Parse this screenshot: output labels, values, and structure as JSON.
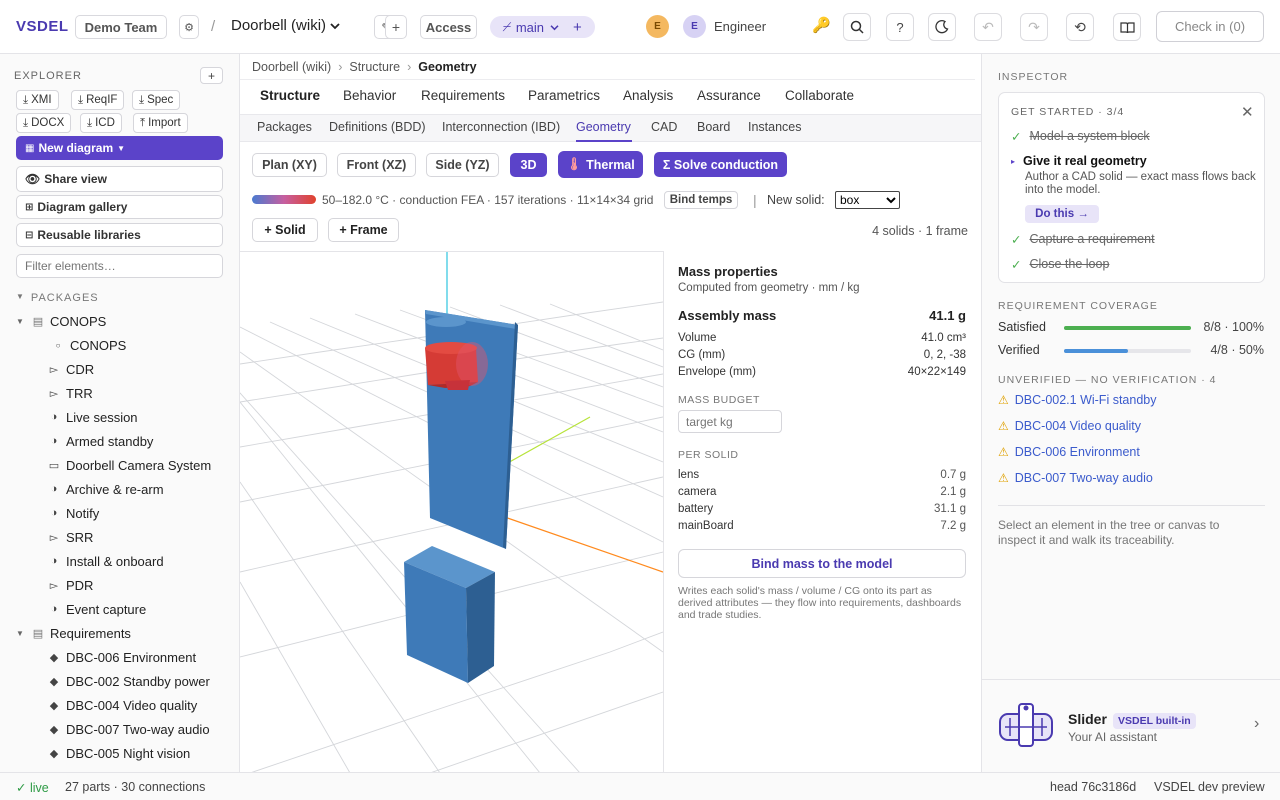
{
  "topbar": {
    "brand": "VSDEL",
    "team": "Demo Team",
    "separator": "/",
    "project": "Doorbell (wiki)",
    "access": "Access",
    "branch": "main",
    "avatar1": "E",
    "avatar2": "E",
    "role": "Engineer",
    "checkin": "Check in (0)"
  },
  "explorer": {
    "title": "EXPLORER",
    "buttons": [
      "XMI",
      "ReqIF",
      "Spec",
      "DOCX",
      "ICD",
      "Import"
    ],
    "new_diagram": "New diagram",
    "share_view": "Share view",
    "gallery": "Diagram gallery",
    "libraries": "Reusable libraries",
    "filter_placeholder": "Filter elements…",
    "packages_label": "PACKAGES",
    "tree": [
      {
        "label": "CONOPS",
        "icon": "package",
        "level": 0,
        "expander": "▼"
      },
      {
        "label": "CONOPS",
        "icon": "circle",
        "level": 2
      },
      {
        "label": "CDR",
        "icon": "flag",
        "level": 1
      },
      {
        "label": "TRR",
        "icon": "flag",
        "level": 1
      },
      {
        "label": "Live session",
        "icon": "half",
        "level": 1
      },
      {
        "label": "Armed standby",
        "icon": "half",
        "level": 1
      },
      {
        "label": "Doorbell Camera System",
        "icon": "rect",
        "level": 1
      },
      {
        "label": "Archive & re-arm",
        "icon": "half",
        "level": 1
      },
      {
        "label": "Notify",
        "icon": "half",
        "level": 1
      },
      {
        "label": "SRR",
        "icon": "flag",
        "level": 1
      },
      {
        "label": "Install & onboard",
        "icon": "half",
        "level": 1
      },
      {
        "label": "PDR",
        "icon": "flag",
        "level": 1
      },
      {
        "label": "Event capture",
        "icon": "half",
        "level": 1
      },
      {
        "label": "Requirements",
        "icon": "package",
        "level": 0,
        "expander": "▼"
      },
      {
        "label": "DBC-006 Environment",
        "icon": "diamond",
        "level": 1
      },
      {
        "label": "DBC-002 Standby power",
        "icon": "diamond",
        "level": 1
      },
      {
        "label": "DBC-004 Video quality",
        "icon": "diamond",
        "level": 1
      },
      {
        "label": "DBC-007 Two-way audio",
        "icon": "diamond",
        "level": 1
      },
      {
        "label": "DBC-005 Night vision",
        "icon": "diamond",
        "level": 1
      }
    ]
  },
  "breadcrumb": [
    "Doorbell (wiki)",
    "Structure",
    "Geometry"
  ],
  "tabs": [
    "Structure",
    "Behavior",
    "Requirements",
    "Parametrics",
    "Analysis",
    "Assurance",
    "Collaborate"
  ],
  "subtabs": [
    "Packages",
    "Definitions (BDD)",
    "Interconnection (IBD)",
    "Geometry",
    "CAD",
    "Board",
    "Instances"
  ],
  "views": [
    "Plan (XY)",
    "Front (XZ)",
    "Side (YZ)",
    "3D"
  ],
  "thermal": "Thermal",
  "solve": "Σ Solve conduction",
  "thermal_info": "50–182.0 °C · conduction FEA · 157 iterations · 11×14×34 grid",
  "bind_temps": "Bind temps",
  "new_solid_label": "New solid:",
  "new_solid_value": "box",
  "add_solid": "+ Solid",
  "add_frame": "+ Frame",
  "solid_count": "4 solids · 1 frame",
  "mass": {
    "title": "Mass properties",
    "subtitle": "Computed from geometry · mm / kg",
    "assembly_label": "Assembly mass",
    "assembly_value": "41.1 g",
    "rows": [
      {
        "k": "Volume",
        "v": "41.0 cm³"
      },
      {
        "k": "CG (mm)",
        "v": "0, 2, -38"
      },
      {
        "k": "Envelope (mm)",
        "v": "40×22×149"
      }
    ],
    "budget_label": "MASS BUDGET",
    "budget_placeholder": "target kg",
    "per_solid_label": "PER SOLID",
    "per_solid": [
      {
        "k": "lens",
        "v": "0.7 g"
      },
      {
        "k": "camera",
        "v": "2.1 g"
      },
      {
        "k": "battery",
        "v": "31.1 g"
      },
      {
        "k": "mainBoard",
        "v": "7.2 g"
      }
    ],
    "bind_button": "Bind mass to the model",
    "bind_note": "Writes each solid's mass / volume / CG onto its part as derived attributes — they flow into requirements, dashboards and trade studies."
  },
  "inspector": {
    "title": "INSPECTOR",
    "get_started": "GET STARTED · 3/4",
    "steps": [
      {
        "label": "Model a system block",
        "done": true
      },
      {
        "label": "Give it real geometry",
        "done": false,
        "desc": "Author a CAD solid — exact mass flows back into the model.",
        "action": "Do this →"
      },
      {
        "label": "Capture a requirement",
        "done": true
      },
      {
        "label": "Close the loop",
        "done": true
      }
    ],
    "coverage_title": "REQUIREMENT COVERAGE",
    "coverage": [
      {
        "label": "Satisfied",
        "value": "8/8 · 100%",
        "fraction": 1.0,
        "color": "#4caf50"
      },
      {
        "label": "Verified",
        "value": "4/8 · 50%",
        "fraction": 0.5,
        "color": "#4a90d9"
      }
    ],
    "unverified_title": "UNVERIFIED — NO VERIFICATION · 4",
    "unverified": [
      "DBC-002.1 Wi-Fi standby",
      "DBC-004 Video quality",
      "DBC-006 Environment",
      "DBC-007 Two-way audio"
    ],
    "hint": "Select an element in the tree or canvas to inspect it and walk its traceability.",
    "assistant_name": "Slider",
    "assistant_badge": "VSDEL built-in",
    "assistant_desc": "Your AI assistant"
  },
  "status": {
    "live": "✓ live",
    "counts": "27 parts · 30 connections",
    "head": "head 76c3186d",
    "env": "VSDEL dev preview"
  }
}
